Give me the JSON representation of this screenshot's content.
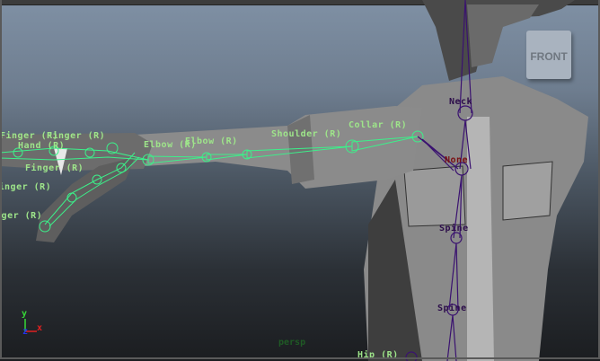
{
  "viewport": {
    "camera_name": "persp",
    "view_cube_label": "FRONT",
    "axes": {
      "y": "y",
      "x": "x",
      "z": "z"
    },
    "joint_labels": {
      "finger_1": "Finger (R)",
      "finger_2": "Finger (R)",
      "finger_3": "Finger (R)",
      "finger_4": "Finger (R)",
      "finger_5": "Finger (R)",
      "hand": "Hand (R)",
      "elbow_1": "Elbow (R)",
      "elbow_2": "Elbow (R)",
      "shoulder": "Shoulder (R)",
      "collar": "Collar (R)",
      "neck": "Neck",
      "none": "None",
      "spine_1": "Spine",
      "spine_2": "Spine",
      "spine_3": "Spine",
      "hip": "Hip (R)"
    },
    "colors": {
      "selected_joints": "#3cf08a",
      "unselected_joints": "#2c0d4a",
      "label_green": "#9ee58a"
    }
  }
}
